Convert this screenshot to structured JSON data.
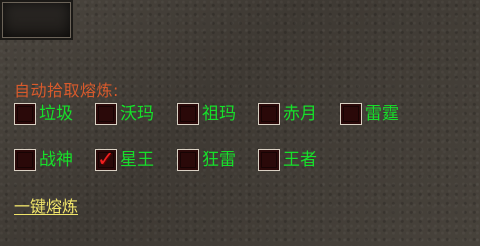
{
  "panel": {
    "title": "自动拾取熔炼:",
    "options": [
      {
        "label": "垃圾",
        "checked": false
      },
      {
        "label": "沃玛",
        "checked": false
      },
      {
        "label": "祖玛",
        "checked": false
      },
      {
        "label": "赤月",
        "checked": false
      },
      {
        "label": "雷霆",
        "checked": false
      },
      {
        "label": "战神",
        "checked": false
      },
      {
        "label": "星王",
        "checked": true
      },
      {
        "label": "狂雷",
        "checked": false
      },
      {
        "label": "王者",
        "checked": false
      }
    ],
    "bottom_link": "一键熔炼",
    "check_mark": "✓"
  },
  "colors": {
    "title": "#d85a2c",
    "option_text": "#16e02a",
    "link": "#f0e46a",
    "check": "#ef2020"
  }
}
